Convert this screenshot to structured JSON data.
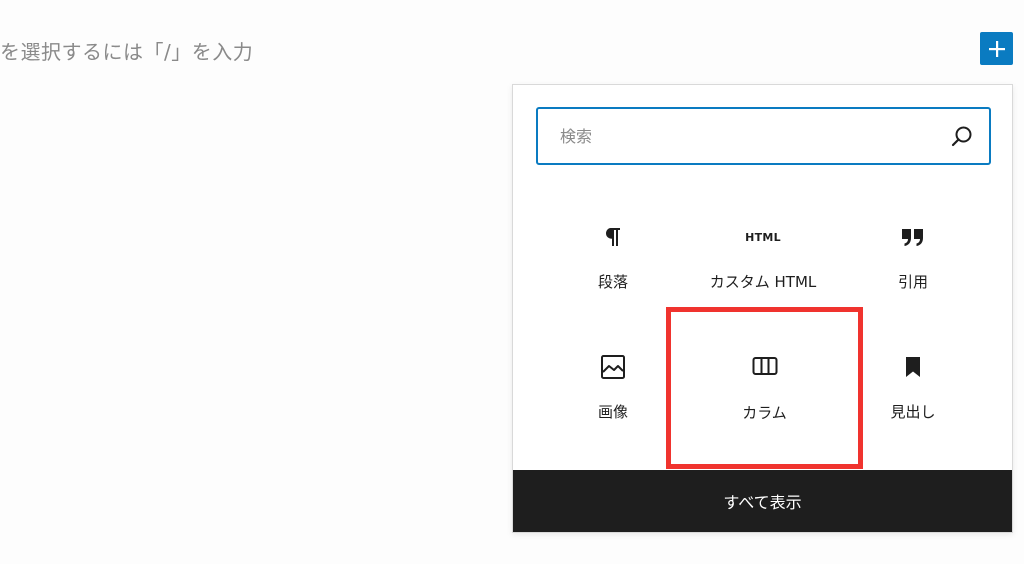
{
  "editor": {
    "placeholder": "を選択するには「/」を入力"
  },
  "inserter": {
    "toggle_icon": "plus-icon",
    "accent_color": "#0a7bc1"
  },
  "search": {
    "placeholder": "検索",
    "icon": "search-icon"
  },
  "blocks": [
    {
      "label": "段落",
      "icon": "paragraph-icon"
    },
    {
      "label": "カスタム HTML",
      "icon": "html-icon",
      "icon_text": "HTML"
    },
    {
      "label": "引用",
      "icon": "quote-icon"
    },
    {
      "label": "画像",
      "icon": "image-icon"
    },
    {
      "label": "カラム",
      "icon": "columns-icon",
      "highlighted": true
    },
    {
      "label": "見出し",
      "icon": "bookmark-icon"
    }
  ],
  "highlight_color": "#f0332e",
  "footer": {
    "show_all_label": "すべて表示"
  }
}
